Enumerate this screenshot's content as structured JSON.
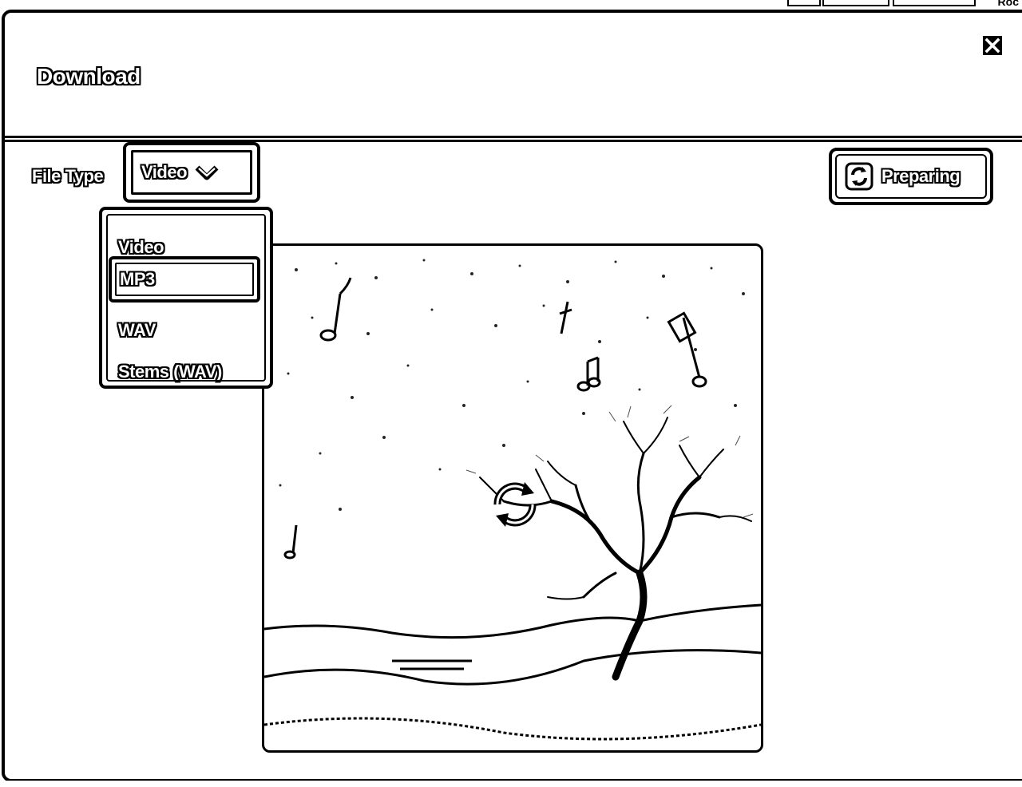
{
  "top_strip": {
    "text": "Roc"
  },
  "dialog": {
    "title": "Download",
    "close_icon": "close-icon"
  },
  "file_type": {
    "label": "File Type",
    "selected": "Video",
    "options": [
      "Video",
      "MP3",
      "WAV",
      "Stems (WAV)"
    ],
    "highlighted": "MP3"
  },
  "status_button": {
    "label": "Preparing",
    "icon": "sync-icon"
  },
  "preview": {
    "image": "tree-with-music-notes-artwork",
    "overlay_icon": "loading-spinner-icon"
  },
  "colors": {
    "ink": "#000000",
    "paper": "#ffffff"
  }
}
